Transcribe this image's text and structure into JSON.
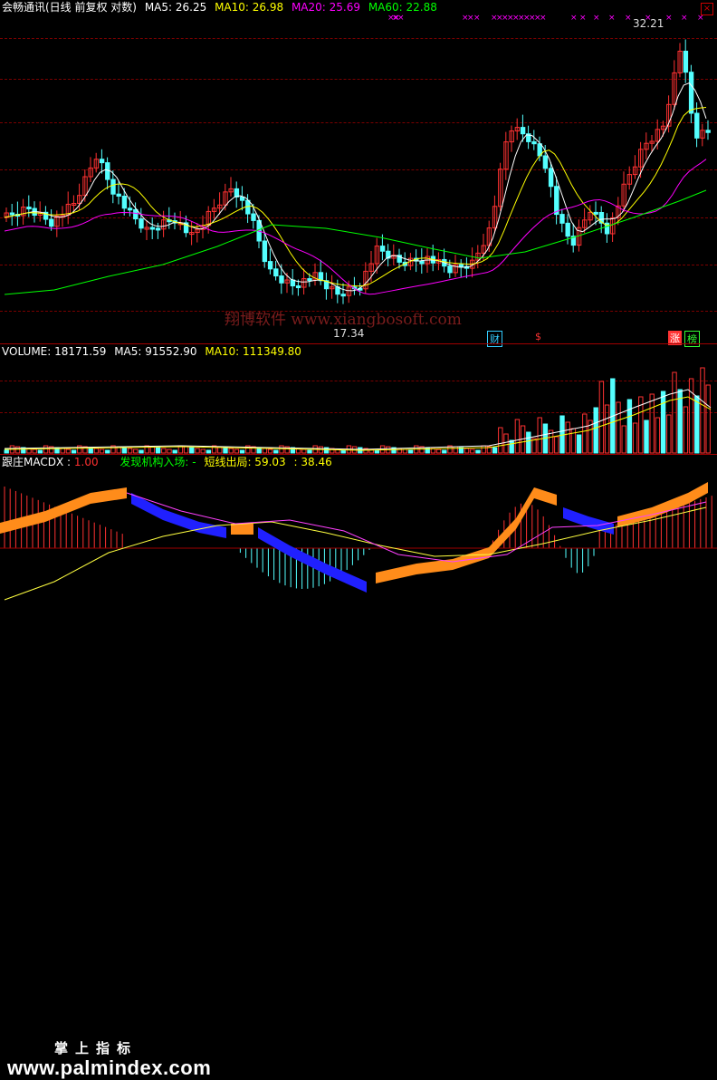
{
  "price_panel": {
    "title": "会畅通讯(日线 前复权 对数)",
    "indicators": [
      {
        "label": "MA5: 26.25",
        "color": "#ffffff"
      },
      {
        "label": "MA10: 26.98",
        "color": "#ffff00"
      },
      {
        "label": "MA20: 25.69",
        "color": "#ff00ff"
      },
      {
        "label": "MA60: 22.88",
        "color": "#00ff00"
      }
    ],
    "high_label": "32.21",
    "low_label": "17.34",
    "marks": {
      "cai": "财",
      "s": "$",
      "zhang": "涨",
      "bang": "榜"
    }
  },
  "volume_panel": {
    "indicators": [
      {
        "label": "VOLUME: 18171.59",
        "color": "#ffffff"
      },
      {
        "label": "MA5: 91552.90",
        "color": "#ffffff"
      },
      {
        "label": "MA10: 111349.80",
        "color": "#ffff00"
      }
    ]
  },
  "macd_panel": {
    "indicators": [
      {
        "label": "跟庄MACDX : ",
        "color": "#ffffff"
      },
      {
        "label": "1.00",
        "color": "#ff3030"
      },
      {
        "label": "发现机构入场: -",
        "color": "#00ff00"
      },
      {
        "label": "短线出局: 59.03",
        "color": "#ffff00"
      },
      {
        "label": ": 38.46",
        "color": "#ffff00"
      }
    ]
  },
  "watermark": "翔博软件 www.xiangbosoft.com",
  "footer": {
    "chinese": "掌上指标",
    "site": "www.palmindex.com"
  },
  "close_glyph": "×",
  "colors": {
    "up": "#ff3232",
    "down": "#54ffff",
    "ma5": "#ffffff",
    "ma10": "#ffff00",
    "ma20": "#ff00ff",
    "ma60": "#00ff00"
  },
  "chart_data": {
    "type": "candlestick",
    "series": [
      {
        "name": "MA5",
        "values": [
          26.25
        ]
      },
      {
        "name": "MA10",
        "values": [
          26.98
        ]
      },
      {
        "name": "MA20",
        "values": [
          25.69
        ]
      },
      {
        "name": "MA60",
        "values": [
          22.88
        ]
      }
    ],
    "price_range": [
      17.34,
      32.21
    ],
    "volume": {
      "last": 18171.59,
      "ma5": 91552.9,
      "ma10": 111349.8
    }
  }
}
